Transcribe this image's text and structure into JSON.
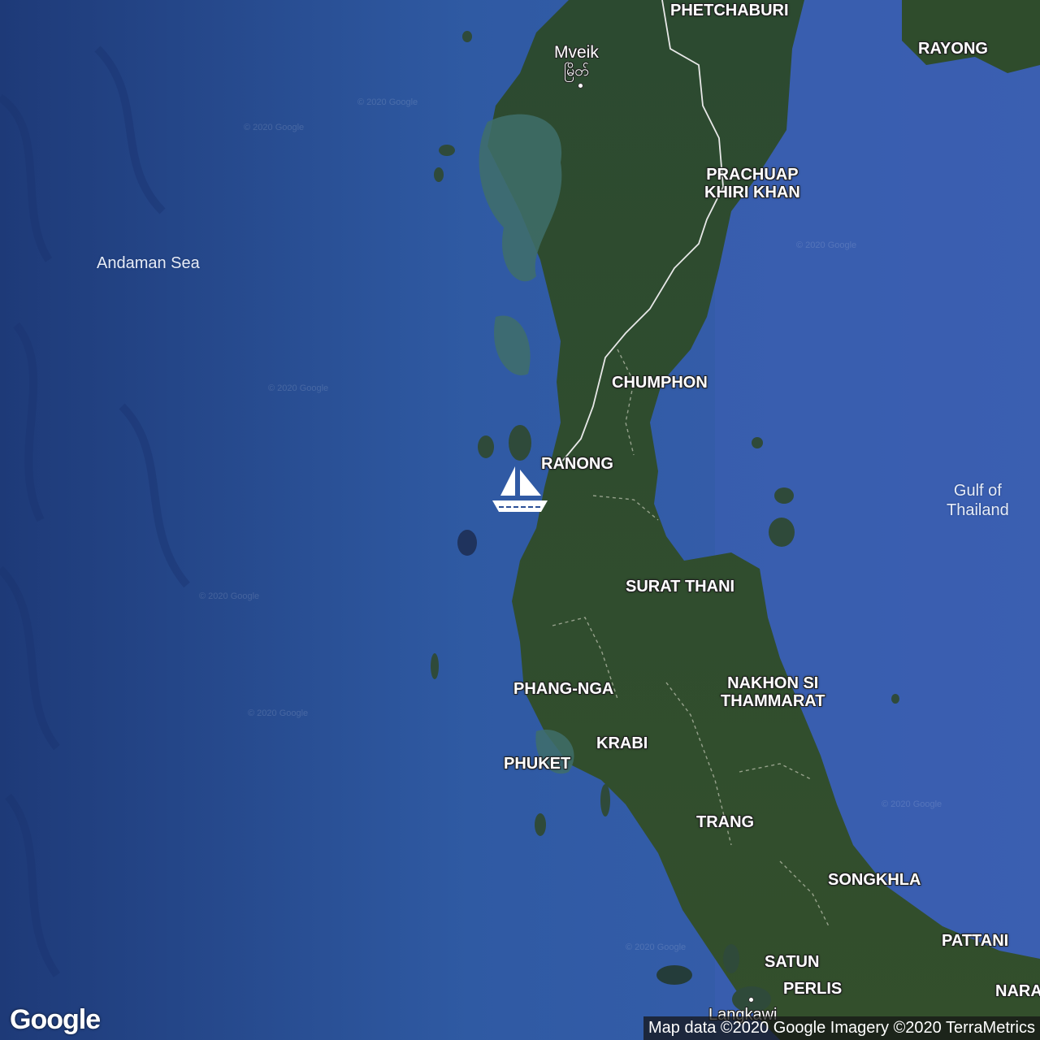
{
  "colors": {
    "sea": "#2b4f97",
    "land": "#2e4a2c",
    "shallow": "#3d6e6c",
    "label": "#ffffff"
  },
  "water_labels": [
    {
      "id": "andaman",
      "text": "Andaman Sea"
    },
    {
      "id": "gulf",
      "text": "Gulf of\nThailand"
    }
  ],
  "cities": [
    {
      "id": "mveik",
      "name": "Mveik",
      "native": "မြိတ်"
    }
  ],
  "provinces": [
    {
      "id": "phetchaburi",
      "text": "PHETCHABURI"
    },
    {
      "id": "rayong",
      "text": "RAYONG"
    },
    {
      "id": "prachuap",
      "text": "PRACHUAP\nKHIRI KHAN"
    },
    {
      "id": "chumphon",
      "text": "CHUMPHON"
    },
    {
      "id": "ranong",
      "text": "RANONG"
    },
    {
      "id": "surat",
      "text": "SURAT THANI"
    },
    {
      "id": "phangnga",
      "text": "PHANG-NGA"
    },
    {
      "id": "nakhon",
      "text": "NAKHON SI\nTHAMMARAT"
    },
    {
      "id": "krabi",
      "text": "KRABI"
    },
    {
      "id": "phuket",
      "text": "PHUKET"
    },
    {
      "id": "trang",
      "text": "TRANG"
    },
    {
      "id": "songkhla",
      "text": "SONGKHLA"
    },
    {
      "id": "pattani",
      "text": "PATTANI"
    },
    {
      "id": "satun",
      "text": "SATUN"
    },
    {
      "id": "perlis",
      "text": "PERLIS"
    },
    {
      "id": "nara",
      "text": "NARA"
    },
    {
      "id": "langkawi",
      "text": "Langkawi"
    }
  ],
  "markers": [
    {
      "id": "vessel",
      "icon": "sailboat-icon"
    }
  ],
  "watermark_text": "© 2020 Google",
  "google_logo": "Google",
  "attribution": "Map data ©2020 Google  Imagery ©2020 TerraMetrics"
}
